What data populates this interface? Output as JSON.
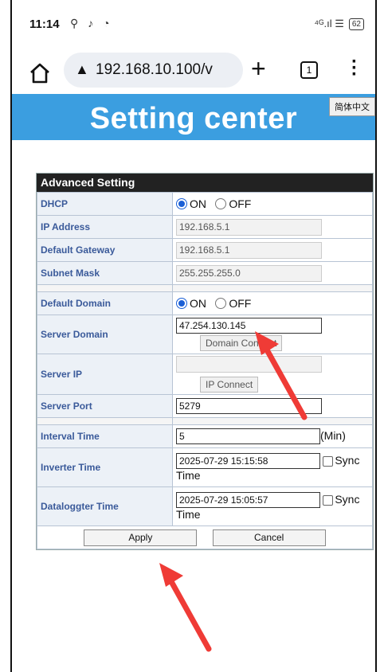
{
  "status_bar": {
    "time": "11:14",
    "left_icons": "⚲ ♪ ◔",
    "signal_text": "⁴ᴳ.ıl ☰",
    "battery": "62"
  },
  "browser": {
    "url": "192.168.10.100/v",
    "warning_icon": "warning-icon",
    "tab_count": "1"
  },
  "page": {
    "banner_title": "Setting center",
    "language_button": "简体中文",
    "panel_title": "Advanced Setting",
    "rows": {
      "dhcp": {
        "label": "DHCP",
        "on": "ON",
        "off": "OFF"
      },
      "ip_address": {
        "label": "IP Address",
        "value": "192.168.5.1"
      },
      "default_gateway": {
        "label": "Default Gateway",
        "value": "192.168.5.1"
      },
      "subnet_mask": {
        "label": "Subnet Mask",
        "value": "255.255.255.0"
      },
      "default_domain": {
        "label": "Default Domain",
        "on": "ON",
        "off": "OFF"
      },
      "server_domain": {
        "label": "Server Domain",
        "value": "47.254.130.145",
        "button": "Domain Connect"
      },
      "server_ip": {
        "label": "Server IP",
        "value": "",
        "button": "IP Connect"
      },
      "server_port": {
        "label": "Server Port",
        "value": "5279"
      },
      "interval_time": {
        "label": "Interval Time",
        "value": "5",
        "unit": "(Min)"
      },
      "inverter_time": {
        "label": "Inverter Time",
        "value": "2025-07-29 15:15:58",
        "sync": "Sync",
        "time_word": "Time"
      },
      "datalogger_time": {
        "label": "Dataloggter Time",
        "value": "2025-07-29 15:05:57",
        "sync": "Sync",
        "time_word": "Time"
      }
    },
    "apply_label": "Apply",
    "cancel_label": "Cancel"
  },
  "annotation_colors": {
    "arrow": "#ef3b36",
    "banner": "#3b9ee0"
  }
}
